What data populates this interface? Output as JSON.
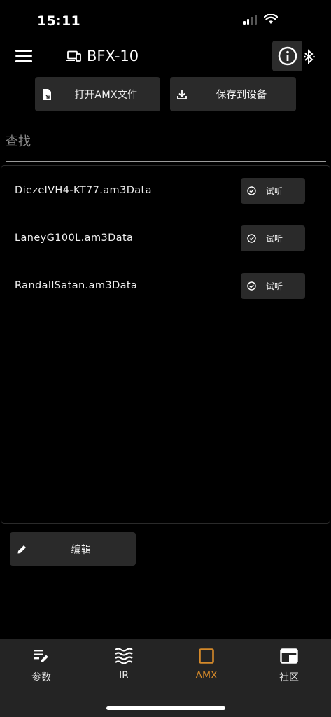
{
  "status_bar": {
    "time": "15:11"
  },
  "header": {
    "device_name": "BFX-10"
  },
  "toolbar": {
    "open_label": "打开AMX文件",
    "save_label": "保存到设备"
  },
  "search": {
    "placeholder": "查找"
  },
  "files": [
    {
      "name": "DiezelVH4-KT77.am3Data",
      "action": "试听"
    },
    {
      "name": "LaneyG100L.am3Data",
      "action": "试听"
    },
    {
      "name": "RandallSatan.am3Data",
      "action": "试听"
    }
  ],
  "edit_label": "编辑",
  "nav": {
    "items": [
      {
        "label": "参数",
        "icon": "edit-list-icon"
      },
      {
        "label": "IR",
        "icon": "waves-icon"
      },
      {
        "label": "AMX",
        "icon": "square-icon",
        "active": true
      },
      {
        "label": "社区",
        "icon": "window-icon"
      }
    ]
  },
  "colors": {
    "accent": "#d4892a",
    "background": "#000000",
    "button": "#2a2a2a",
    "nav_bg": "#242424"
  }
}
